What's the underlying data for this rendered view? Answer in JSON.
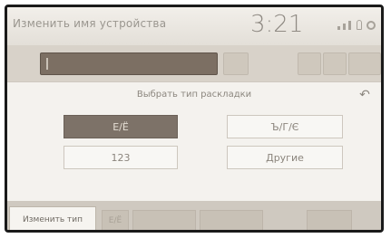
{
  "status_bar": {
    "title": "Изменить имя устройства",
    "time": "3:21"
  },
  "dialog": {
    "title": "Выбрать тип раскладки",
    "back_icon": "↶",
    "options": [
      {
        "label": "Е/Ё",
        "selected": true
      },
      {
        "label": "Ъ/Г/Є",
        "selected": false
      },
      {
        "label": "123",
        "selected": false
      },
      {
        "label": "Другие",
        "selected": false
      }
    ]
  },
  "bottom_bar": {
    "change_type_label": "Изменить тип",
    "first_key_label": "Е/Ё"
  },
  "colors": {
    "selected_option": "#7d7268",
    "field": "#7c6f63"
  }
}
